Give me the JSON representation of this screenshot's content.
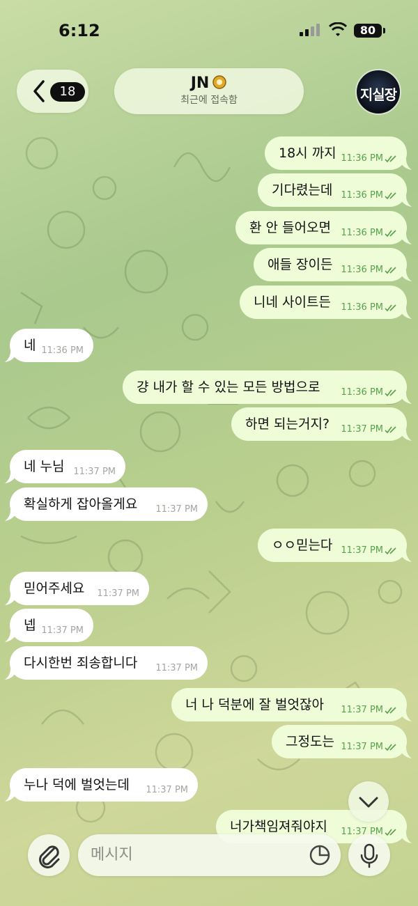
{
  "status_bar": {
    "time": "6:12",
    "battery": "80"
  },
  "header": {
    "back_badge": "18",
    "title": "JN",
    "subtitle": "최근에 접속함",
    "avatar_text": "지실장"
  },
  "messages": [
    {
      "dir": "out",
      "text": "18시 까지",
      "time": "11:36 PM"
    },
    {
      "dir": "out",
      "text": "기다렸는데",
      "time": "11:36 PM"
    },
    {
      "dir": "out",
      "text": "환 안 들어오면",
      "time": "11:36 PM"
    },
    {
      "dir": "out",
      "text": "애들 장이든",
      "time": "11:36 PM"
    },
    {
      "dir": "out",
      "text": "니네 사이트든",
      "time": "11:36 PM"
    },
    {
      "dir": "in",
      "text": "네",
      "time": "11:36 PM"
    },
    {
      "dir": "out",
      "text": "걍 내가 할 수 있는 모든 방법으로",
      "time": "11:36 PM"
    },
    {
      "dir": "out",
      "text": "하면 되는거지?",
      "time": "11:37 PM"
    },
    {
      "dir": "in",
      "text": "네 누님",
      "time": "11:37 PM"
    },
    {
      "dir": "in",
      "text": "확실하게 잡아올게요",
      "time": "11:37 PM"
    },
    {
      "dir": "out",
      "text": "ㅇㅇ믿는다",
      "time": "11:37 PM"
    },
    {
      "dir": "in",
      "text": "믿어주세요",
      "time": "11:37 PM"
    },
    {
      "dir": "in",
      "text": "넵",
      "time": "11:37 PM"
    },
    {
      "dir": "in",
      "text": "다시한번 죄송합니다",
      "time": "11:37 PM"
    },
    {
      "dir": "out",
      "text": "너 나 덕분에 잘 벌엇잖아",
      "time": "11:37 PM"
    },
    {
      "dir": "out",
      "text": "그정도는",
      "time": "11:37 PM"
    },
    {
      "dir": "in",
      "text": "누나 덕에 벌엇는데",
      "time": "11:37 PM"
    },
    {
      "dir": "out",
      "text": "너가책임져줘야지",
      "time": "11:37 PM"
    }
  ],
  "composer": {
    "placeholder": "메시지"
  },
  "icons": {
    "back": "chevron-left-icon",
    "medal": "gold-medal-icon",
    "scroll": "chevron-down-icon",
    "attach": "paperclip-icon",
    "sticker": "sticker-icon",
    "mic": "microphone-icon",
    "read": "double-check-icon"
  },
  "colors": {
    "incoming": "#ffffff",
    "outgoing": "#eefcd7",
    "read_check": "#57a24a"
  }
}
